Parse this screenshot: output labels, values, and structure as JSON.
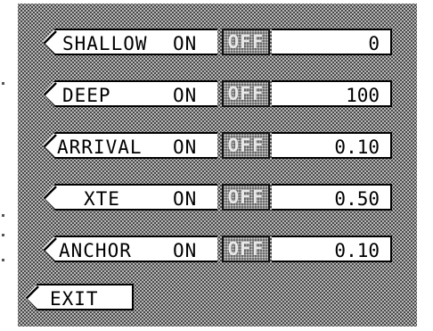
{
  "alarms": [
    {
      "id": "shallow",
      "label": "SHALLOW",
      "on_label": "ON",
      "off_label": "OFF",
      "state": "OFF",
      "value": "0"
    },
    {
      "id": "deep",
      "label": "DEEP",
      "on_label": "ON",
      "off_label": "OFF",
      "state": "OFF",
      "value": "100"
    },
    {
      "id": "arrival",
      "label": "ARRIVAL",
      "on_label": "ON",
      "off_label": "OFF",
      "state": "OFF",
      "value": "0.10"
    },
    {
      "id": "xte",
      "label": "XTE",
      "on_label": "ON",
      "off_label": "OFF",
      "state": "OFF",
      "value": "0.50"
    },
    {
      "id": "anchor",
      "label": "ANCHOR",
      "on_label": "ON",
      "off_label": "OFF",
      "state": "OFF",
      "value": "0.10"
    }
  ],
  "exit_label": "EXIT",
  "colors": {
    "screen_dither": "#b8b8b8",
    "off_highlight": "#6b6b6b",
    "field_background": "#ffffff",
    "outline": "#000000"
  },
  "icons": {
    "row_pointer": "left-arrow-tab"
  }
}
